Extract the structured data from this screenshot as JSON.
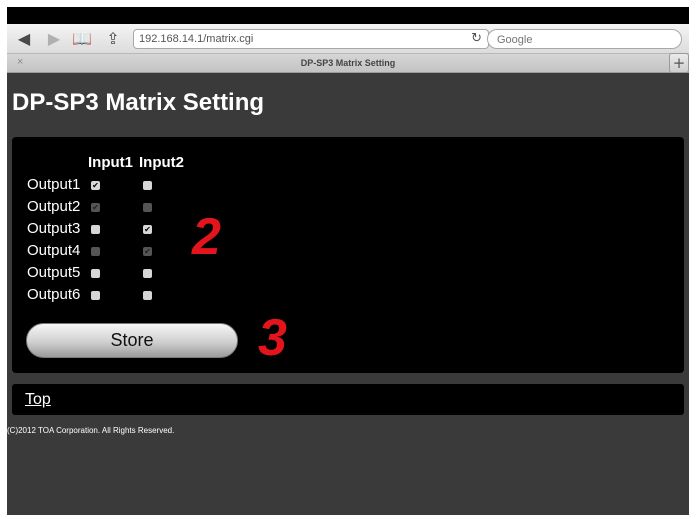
{
  "browser": {
    "url": "192.168.14.1/matrix.cgi",
    "search_placeholder": "Google",
    "tab_title": "DP-SP3 Matrix Setting",
    "tab_close": "×",
    "new_tab": "+",
    "back_icon": "◀",
    "forward_icon": "▶",
    "bookmarks_icon": "📖",
    "share_icon": "⇪",
    "reload_icon": "↻"
  },
  "page": {
    "title": "DP-SP3 Matrix Setting",
    "matrix": {
      "columns": [
        "Input1",
        "Input2"
      ],
      "rows": [
        {
          "label": "Output1",
          "input1": {
            "checked": true,
            "enabled": true
          },
          "input2": {
            "checked": false,
            "enabled": true
          }
        },
        {
          "label": "Output2",
          "input1": {
            "checked": true,
            "enabled": false
          },
          "input2": {
            "checked": false,
            "enabled": false
          }
        },
        {
          "label": "Output3",
          "input1": {
            "checked": false,
            "enabled": true
          },
          "input2": {
            "checked": true,
            "enabled": true
          }
        },
        {
          "label": "Output4",
          "input1": {
            "checked": false,
            "enabled": false
          },
          "input2": {
            "checked": true,
            "enabled": false
          }
        },
        {
          "label": "Output5",
          "input1": {
            "checked": false,
            "enabled": true
          },
          "input2": {
            "checked": false,
            "enabled": true
          }
        },
        {
          "label": "Output6",
          "input1": {
            "checked": false,
            "enabled": true
          },
          "input2": {
            "checked": false,
            "enabled": true
          }
        }
      ],
      "check_glyph": "✔"
    },
    "store_label": "Store",
    "callouts": [
      "2",
      "3"
    ],
    "top_link": "Top",
    "copyright": "(C)2012 TOA Corporation. All Rights Reserved."
  },
  "colors": {
    "page_bg": "#3a3a3a",
    "panel_bg": "#000000",
    "callout": "#e4141c"
  }
}
